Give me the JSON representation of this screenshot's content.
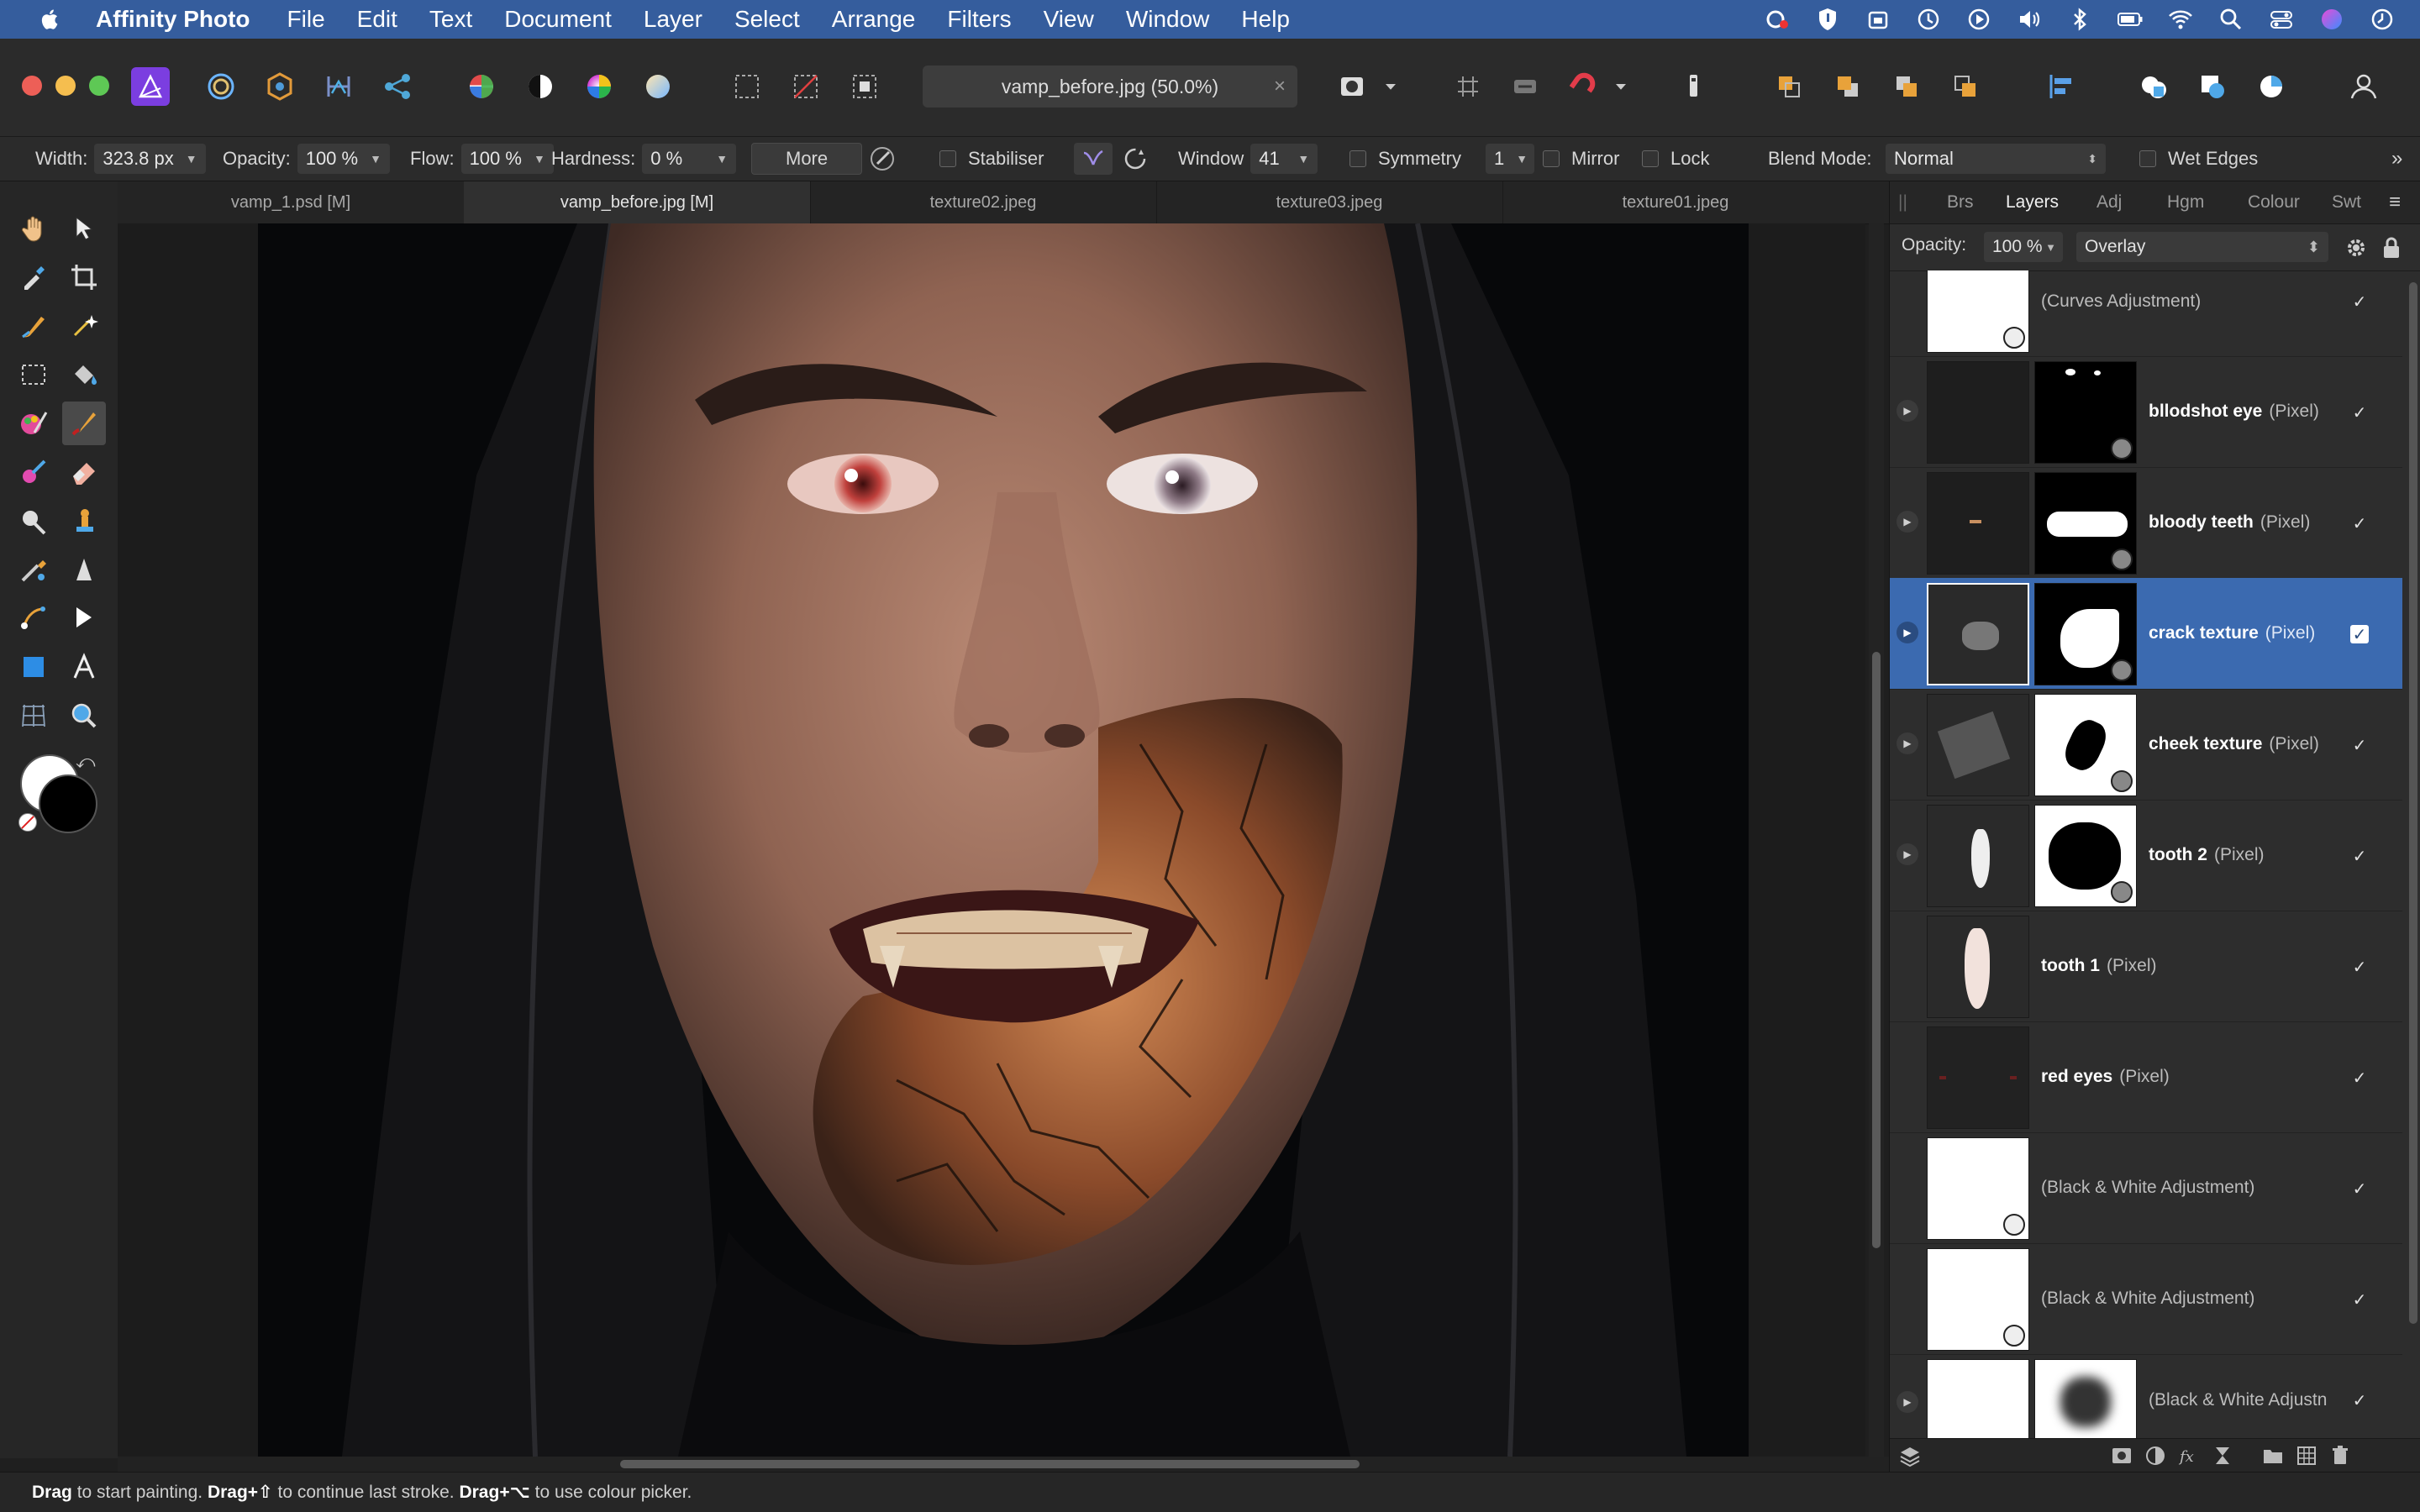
{
  "menubar": {
    "app_name": "Affinity Photo",
    "items": [
      "File",
      "Edit",
      "Text",
      "Document",
      "Layer",
      "Select",
      "Arrange",
      "Filters",
      "View",
      "Window",
      "Help"
    ]
  },
  "toolbar": {
    "document_title": "vamp_before.jpg (50.0%)",
    "close_glyph": "×"
  },
  "context": {
    "width_label": "Width:",
    "width_value": "323.8 px",
    "opacity_label": "Opacity:",
    "opacity_value": "100 %",
    "flow_label": "Flow:",
    "flow_value": "100 %",
    "hardness_label": "Hardness:",
    "hardness_value": "0 %",
    "more_label": "More",
    "stabiliser_label": "Stabiliser",
    "window_label": "Window",
    "window_value": "41",
    "symmetry_label": "Symmetry",
    "symmetry_value": "1",
    "mirror_label": "Mirror",
    "lock_label": "Lock",
    "blend_label": "Blend Mode:",
    "blend_value": "Normal",
    "wet_edges_label": "Wet Edges"
  },
  "tabs": [
    {
      "label": "vamp_1.psd [M]",
      "active": false
    },
    {
      "label": "vamp_before.jpg [M]",
      "active": true
    },
    {
      "label": "texture02.jpeg",
      "active": false
    },
    {
      "label": "texture03.jpeg",
      "active": false
    },
    {
      "label": "texture01.jpeg",
      "active": false
    }
  ],
  "panel": {
    "tabs": [
      "Brs",
      "Layers",
      "Adj",
      "Hgm",
      "Colour",
      "Swt"
    ],
    "active_tab": "Layers",
    "opacity_label": "Opacity:",
    "opacity_value": "100 %",
    "blend_value": "Overlay",
    "layers": [
      {
        "name": "",
        "type": "(Curves Adjustment)",
        "visible": true,
        "selected": false
      },
      {
        "name": "bllodshot eye",
        "type": "(Pixel)",
        "visible": true,
        "selected": false
      },
      {
        "name": "bloody teeth",
        "type": "(Pixel)",
        "visible": true,
        "selected": false
      },
      {
        "name": "crack texture",
        "type": "(Pixel)",
        "visible": true,
        "selected": true
      },
      {
        "name": "cheek texture",
        "type": "(Pixel)",
        "visible": true,
        "selected": false
      },
      {
        "name": "tooth 2",
        "type": "(Pixel)",
        "visible": true,
        "selected": false
      },
      {
        "name": "tooth 1",
        "type": "(Pixel)",
        "visible": true,
        "selected": false
      },
      {
        "name": "red eyes",
        "type": "(Pixel)",
        "visible": true,
        "selected": false
      },
      {
        "name": "",
        "type": "(Black & White Adjustment)",
        "visible": true,
        "selected": false
      },
      {
        "name": "",
        "type": "(Black & White Adjustment)",
        "visible": true,
        "selected": false
      },
      {
        "name": "",
        "type": "(Black & White Adjustn",
        "visible": true,
        "selected": false
      }
    ],
    "check_glyph": "✓",
    "expand_glyph": "▶"
  },
  "status": {
    "b1": "Drag",
    "t1": " to start painting. ",
    "b2": "Drag+⇧",
    "t2": " to continue last stroke. ",
    "b3": "Drag+⌥",
    "t3": " to use colour picker."
  },
  "colors": {
    "menubar": "#355d9d",
    "selection": "#3b6ab0",
    "panel_bg": "#2d2d2d"
  }
}
